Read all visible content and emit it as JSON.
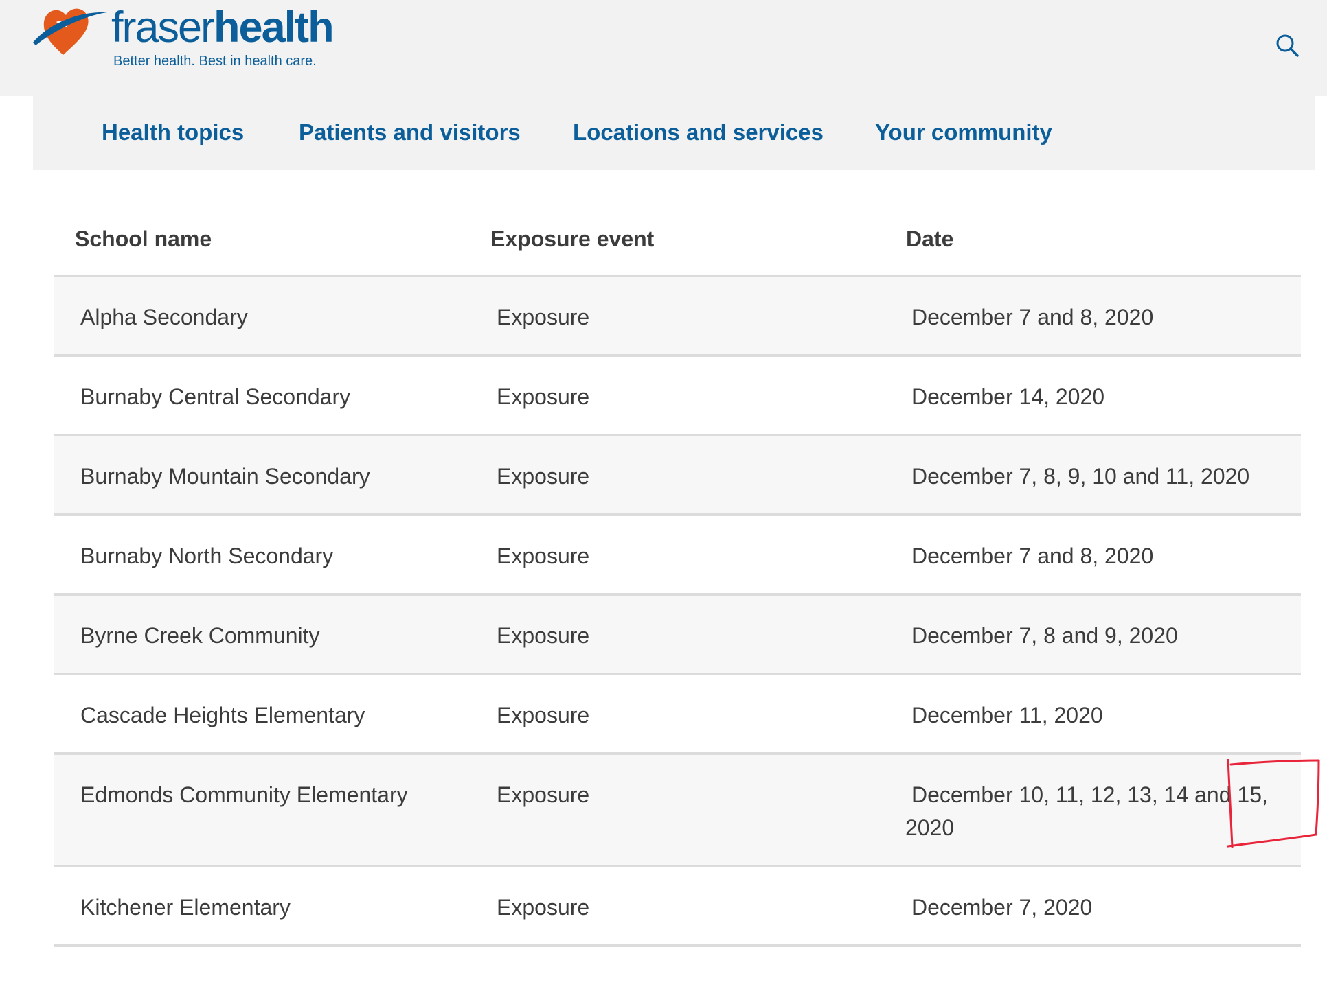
{
  "brand": {
    "name_light": "fraser",
    "name_bold": "health",
    "tagline": "Better health. Best in health care.",
    "colors": {
      "primary": "#0b5e99",
      "accent": "#e35a1c",
      "annotation": "#e8253a"
    }
  },
  "header": {
    "search_icon": "search-icon"
  },
  "nav": {
    "items": [
      {
        "label": "Health topics"
      },
      {
        "label": "Patients and visitors"
      },
      {
        "label": "Locations and services"
      },
      {
        "label": "Your community"
      }
    ]
  },
  "table": {
    "headers": [
      "School name",
      "Exposure event",
      "Date"
    ],
    "rows": [
      {
        "school": "Alpha Secondary",
        "event": "Exposure",
        "date": "December 7 and 8, 2020"
      },
      {
        "school": "Burnaby Central Secondary",
        "event": "Exposure",
        "date": "December 14, 2020"
      },
      {
        "school": "Burnaby Mountain Secondary",
        "event": "Exposure",
        "date": "December 7, 8, 9, 10 and 11, 2020"
      },
      {
        "school": "Burnaby North Secondary",
        "event": "Exposure",
        "date": "December 7 and 8, 2020"
      },
      {
        "school": "Byrne Creek Community",
        "event": "Exposure",
        "date": "December 7, 8 and 9, 2020"
      },
      {
        "school": "Cascade Heights Elementary",
        "event": "Exposure",
        "date": "December 11, 2020"
      },
      {
        "school": "Edmonds Community Elementary",
        "event": "Exposure",
        "date": "December 10, 11, 12, 13, 14 and 15,",
        "date_line2": "2020"
      },
      {
        "school": "Kitchener Elementary",
        "event": "Exposure",
        "date": "December 7, 2020"
      }
    ]
  }
}
